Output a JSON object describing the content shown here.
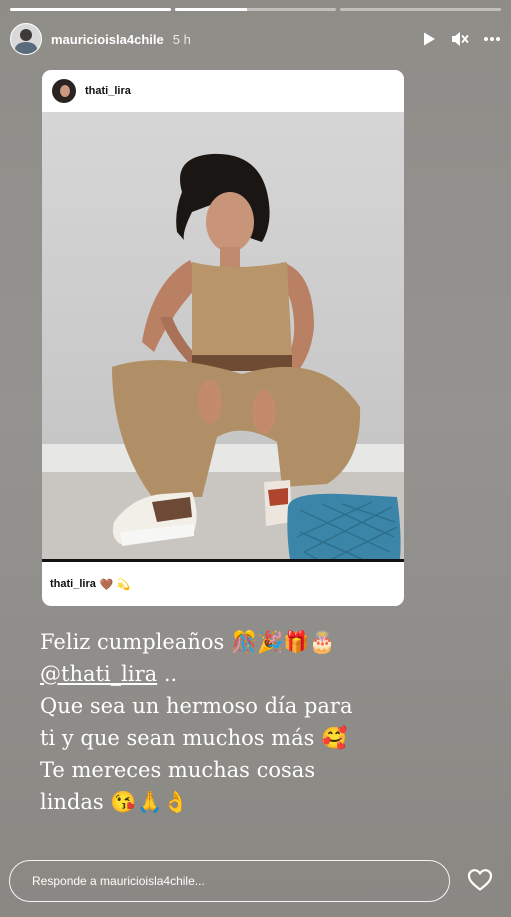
{
  "progress": [
    1.0,
    0.45,
    0.0
  ],
  "header": {
    "username": "mauricioisla4chile",
    "time": "5 h",
    "icons": [
      "play-icon",
      "mute-icon",
      "more-icon"
    ]
  },
  "post": {
    "username": "thati_lira",
    "caption_user": "thati_lira",
    "caption_emoji": "🤎 💫"
  },
  "story_text": {
    "line1": "Feliz cumpleaños 🎊🎉🎁🎂",
    "mention": "@thati_lira",
    "mention_suffix": " ..",
    "line3": "Que sea un hermoso día para",
    "line4": "ti y que sean muchos más 🥰",
    "line5": "Te mereces muchas cosas",
    "line6": "lindas 😘🙏👌"
  },
  "reply": {
    "placeholder": "Responde a mauricioisla4chile..."
  },
  "colors": {
    "background": "#8f8d88",
    "text": "#ffffff"
  }
}
